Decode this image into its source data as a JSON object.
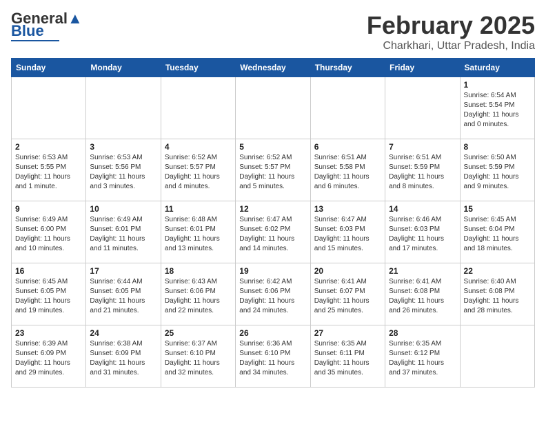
{
  "header": {
    "logo_general": "General",
    "logo_blue": "Blue",
    "month_title": "February 2025",
    "location": "Charkhari, Uttar Pradesh, India"
  },
  "calendar": {
    "weekdays": [
      "Sunday",
      "Monday",
      "Tuesday",
      "Wednesday",
      "Thursday",
      "Friday",
      "Saturday"
    ],
    "weeks": [
      [
        {
          "day": "",
          "info": ""
        },
        {
          "day": "",
          "info": ""
        },
        {
          "day": "",
          "info": ""
        },
        {
          "day": "",
          "info": ""
        },
        {
          "day": "",
          "info": ""
        },
        {
          "day": "",
          "info": ""
        },
        {
          "day": "1",
          "info": "Sunrise: 6:54 AM\nSunset: 5:54 PM\nDaylight: 11 hours\nand 0 minutes."
        }
      ],
      [
        {
          "day": "2",
          "info": "Sunrise: 6:53 AM\nSunset: 5:55 PM\nDaylight: 11 hours\nand 1 minute."
        },
        {
          "day": "3",
          "info": "Sunrise: 6:53 AM\nSunset: 5:56 PM\nDaylight: 11 hours\nand 3 minutes."
        },
        {
          "day": "4",
          "info": "Sunrise: 6:52 AM\nSunset: 5:57 PM\nDaylight: 11 hours\nand 4 minutes."
        },
        {
          "day": "5",
          "info": "Sunrise: 6:52 AM\nSunset: 5:57 PM\nDaylight: 11 hours\nand 5 minutes."
        },
        {
          "day": "6",
          "info": "Sunrise: 6:51 AM\nSunset: 5:58 PM\nDaylight: 11 hours\nand 6 minutes."
        },
        {
          "day": "7",
          "info": "Sunrise: 6:51 AM\nSunset: 5:59 PM\nDaylight: 11 hours\nand 8 minutes."
        },
        {
          "day": "8",
          "info": "Sunrise: 6:50 AM\nSunset: 5:59 PM\nDaylight: 11 hours\nand 9 minutes."
        }
      ],
      [
        {
          "day": "9",
          "info": "Sunrise: 6:49 AM\nSunset: 6:00 PM\nDaylight: 11 hours\nand 10 minutes."
        },
        {
          "day": "10",
          "info": "Sunrise: 6:49 AM\nSunset: 6:01 PM\nDaylight: 11 hours\nand 11 minutes."
        },
        {
          "day": "11",
          "info": "Sunrise: 6:48 AM\nSunset: 6:01 PM\nDaylight: 11 hours\nand 13 minutes."
        },
        {
          "day": "12",
          "info": "Sunrise: 6:47 AM\nSunset: 6:02 PM\nDaylight: 11 hours\nand 14 minutes."
        },
        {
          "day": "13",
          "info": "Sunrise: 6:47 AM\nSunset: 6:03 PM\nDaylight: 11 hours\nand 15 minutes."
        },
        {
          "day": "14",
          "info": "Sunrise: 6:46 AM\nSunset: 6:03 PM\nDaylight: 11 hours\nand 17 minutes."
        },
        {
          "day": "15",
          "info": "Sunrise: 6:45 AM\nSunset: 6:04 PM\nDaylight: 11 hours\nand 18 minutes."
        }
      ],
      [
        {
          "day": "16",
          "info": "Sunrise: 6:45 AM\nSunset: 6:05 PM\nDaylight: 11 hours\nand 19 minutes."
        },
        {
          "day": "17",
          "info": "Sunrise: 6:44 AM\nSunset: 6:05 PM\nDaylight: 11 hours\nand 21 minutes."
        },
        {
          "day": "18",
          "info": "Sunrise: 6:43 AM\nSunset: 6:06 PM\nDaylight: 11 hours\nand 22 minutes."
        },
        {
          "day": "19",
          "info": "Sunrise: 6:42 AM\nSunset: 6:06 PM\nDaylight: 11 hours\nand 24 minutes."
        },
        {
          "day": "20",
          "info": "Sunrise: 6:41 AM\nSunset: 6:07 PM\nDaylight: 11 hours\nand 25 minutes."
        },
        {
          "day": "21",
          "info": "Sunrise: 6:41 AM\nSunset: 6:08 PM\nDaylight: 11 hours\nand 26 minutes."
        },
        {
          "day": "22",
          "info": "Sunrise: 6:40 AM\nSunset: 6:08 PM\nDaylight: 11 hours\nand 28 minutes."
        }
      ],
      [
        {
          "day": "23",
          "info": "Sunrise: 6:39 AM\nSunset: 6:09 PM\nDaylight: 11 hours\nand 29 minutes."
        },
        {
          "day": "24",
          "info": "Sunrise: 6:38 AM\nSunset: 6:09 PM\nDaylight: 11 hours\nand 31 minutes."
        },
        {
          "day": "25",
          "info": "Sunrise: 6:37 AM\nSunset: 6:10 PM\nDaylight: 11 hours\nand 32 minutes."
        },
        {
          "day": "26",
          "info": "Sunrise: 6:36 AM\nSunset: 6:10 PM\nDaylight: 11 hours\nand 34 minutes."
        },
        {
          "day": "27",
          "info": "Sunrise: 6:35 AM\nSunset: 6:11 PM\nDaylight: 11 hours\nand 35 minutes."
        },
        {
          "day": "28",
          "info": "Sunrise: 6:35 AM\nSunset: 6:12 PM\nDaylight: 11 hours\nand 37 minutes."
        },
        {
          "day": "",
          "info": ""
        }
      ]
    ]
  }
}
